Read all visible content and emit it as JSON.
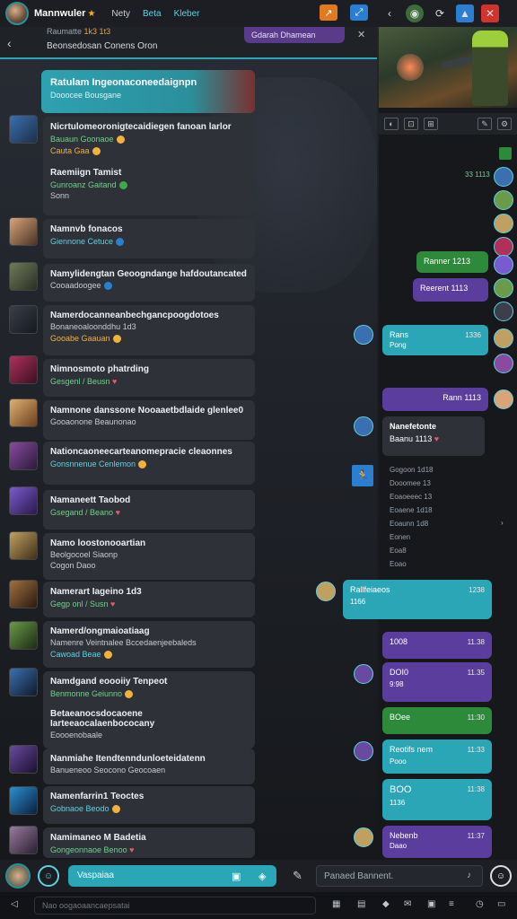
{
  "topbar": {
    "user_name": "Mannwuler",
    "nav": [
      "Nety",
      "Beta",
      "Kleber"
    ],
    "right_icons": [
      "chevron-left-icon",
      "game-icon",
      "refresh-icon",
      "drop-icon",
      "close-icon"
    ]
  },
  "subheader": {
    "line1": "Raumatte",
    "line1_badge": "1k3 1t3",
    "line2": "Beonsedosan Conens Oron",
    "pill": "Gdarah Dhamean"
  },
  "pinned": {
    "title": "Ratulam Ingeonaconeedaignpn",
    "sub": "Dooocee Bousgane"
  },
  "left_messages": [
    {
      "title": "Nicrtulomeoronigtecaidiegen fanoan larlor",
      "l1": "Bauaun Goonaoe",
      "l2": "Cauta Gaa"
    },
    {
      "title": "Raemiign Tamist",
      "l1": "Gunroanz Gaitand",
      "l2": "Sonn"
    },
    {
      "title": "Namnvb fonacos",
      "l1": "Giennone Cetuce"
    },
    {
      "title": "Namylidengtan Geoogndange hafdoutancated",
      "l1": "Cooaadoogee"
    },
    {
      "title": "Namerdocanneanbechgancpoogdotoes",
      "l1": "Bonaneoaloonddhu 1d3",
      "l2": "Gooabe Gaauan"
    },
    {
      "title": "Nimnosmoto phatrding",
      "l1": "Gesgenl / Beusn"
    },
    {
      "title": "Namnone danssone Nooaaetbdlaide glenlee0",
      "l1": "Gooaonone Beaunonao"
    },
    {
      "title": "Nationcaoneecarteanomepracie cleaonnes",
      "l1": "Gonsnnenue Cenlemon"
    },
    {
      "title": "Namaneett Taobod",
      "l1": "Gsegand / Beano"
    },
    {
      "title": "Namo loostonooartian",
      "l1": "Beolgocoel Siaonp",
      "l2": "Cogon Daoo"
    },
    {
      "title": "Namerart Iageino 1d3",
      "l1": "Gegp onl / Susn"
    },
    {
      "title": "Namerd/ongmaioatiaag",
      "l1": "Namenre Veintnalee Bccedaenjeebaleds",
      "l2": "Cawoad Beae"
    },
    {
      "title": "Namdgand eoooiiy Tenpeot",
      "l1": "Benmonne Geiunno"
    },
    {
      "title": "Betaeanocsdocaoene Iarteeaocalaenbococany",
      "l1": "Eoooenobaale"
    },
    {
      "title": "Nanmiahe Itendtenndunloeteidatenn",
      "l1": "Banueneoo Seocono Geocoaen"
    },
    {
      "title": "Namenfarrin1 Teoctes",
      "l1": "Gobnaoe Beodo"
    },
    {
      "title": "Namimaneo M Badetia",
      "l1": "Gongeonnaoe Benoo"
    }
  ],
  "right": {
    "bubbles": [
      {
        "text": "Ranner 1213",
        "time": ""
      },
      {
        "text": "Reerent 1113",
        "time": ""
      },
      {
        "text": "Rans",
        "sub": "Pong",
        "time": "1336"
      },
      {
        "text": "Rann 1113",
        "time": ""
      },
      {
        "text": "Nanefetonte",
        "sub": "Baanu 1113",
        "time": ""
      },
      {
        "text": "Rallfeiaeos",
        "sub": "1166",
        "time": "1238"
      },
      {
        "text": "1008",
        "time": "11.38"
      },
      {
        "text": "DOI0",
        "sub": "9:98",
        "time": "11.35"
      },
      {
        "text": "BOee",
        "time": "11:30"
      },
      {
        "text": "Reotifs nem",
        "sub": "Pooo",
        "time": "11:33"
      },
      {
        "text": "BOO",
        "sub": "1136",
        "time": "11:38"
      },
      {
        "text": "Nebenb",
        "sub": "Daao",
        "time": "11:37"
      }
    ],
    "tick_lines": [
      "Gogoon 1d18",
      "Dooomee 13",
      "Eoaoeeec 13",
      "Eoaene 1d18",
      "Eoaunn 1d8",
      "Eonen",
      "Eoa8",
      "Eoao"
    ],
    "top_tick": "33 1113"
  },
  "bottom": {
    "left_input": "Vaspaiaa",
    "right_input": "Panaed Bannent."
  },
  "sysbar": {
    "field": "Nao oogaoaancaepsatai"
  }
}
